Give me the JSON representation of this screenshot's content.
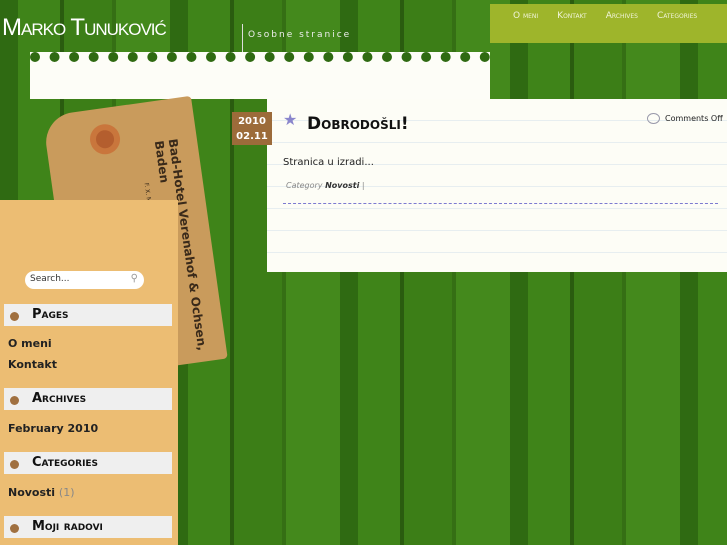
{
  "header": {
    "site_title": "Marko Tunuković",
    "tagline": "Osobne stranice"
  },
  "nav": {
    "items": [
      "O meni",
      "Kontakt",
      "Archives",
      "Categories"
    ]
  },
  "tag_image": {
    "line1": "Bad-Hotel Verenahof & Ochsen, Baden",
    "line2": "F. X. MARKWALDER, Besitzer"
  },
  "sidebar": {
    "search_placeholder": "Search...",
    "widgets": [
      {
        "title": "Pages",
        "items": [
          "O meni",
          "Kontakt"
        ]
      },
      {
        "title": "Archives",
        "items": [
          "February 2010"
        ]
      },
      {
        "title": "Categories",
        "items": [
          {
            "label": "Novosti",
            "count": "(1)"
          }
        ]
      },
      {
        "title": "Moji radovi"
      }
    ]
  },
  "post": {
    "year": "2010",
    "date": "02.11",
    "title": "Dobrodošli!",
    "comments": "Comments Off",
    "body": "Stranica u izradi...",
    "category_label": "Category",
    "category": "Novosti",
    "separator": "|"
  },
  "colors": {
    "nav_bg": "#9eb52b",
    "sidebar_bg": "#ecbd73",
    "content_bg": "#fdfdf6",
    "date_bg": "#9c6b3a"
  }
}
